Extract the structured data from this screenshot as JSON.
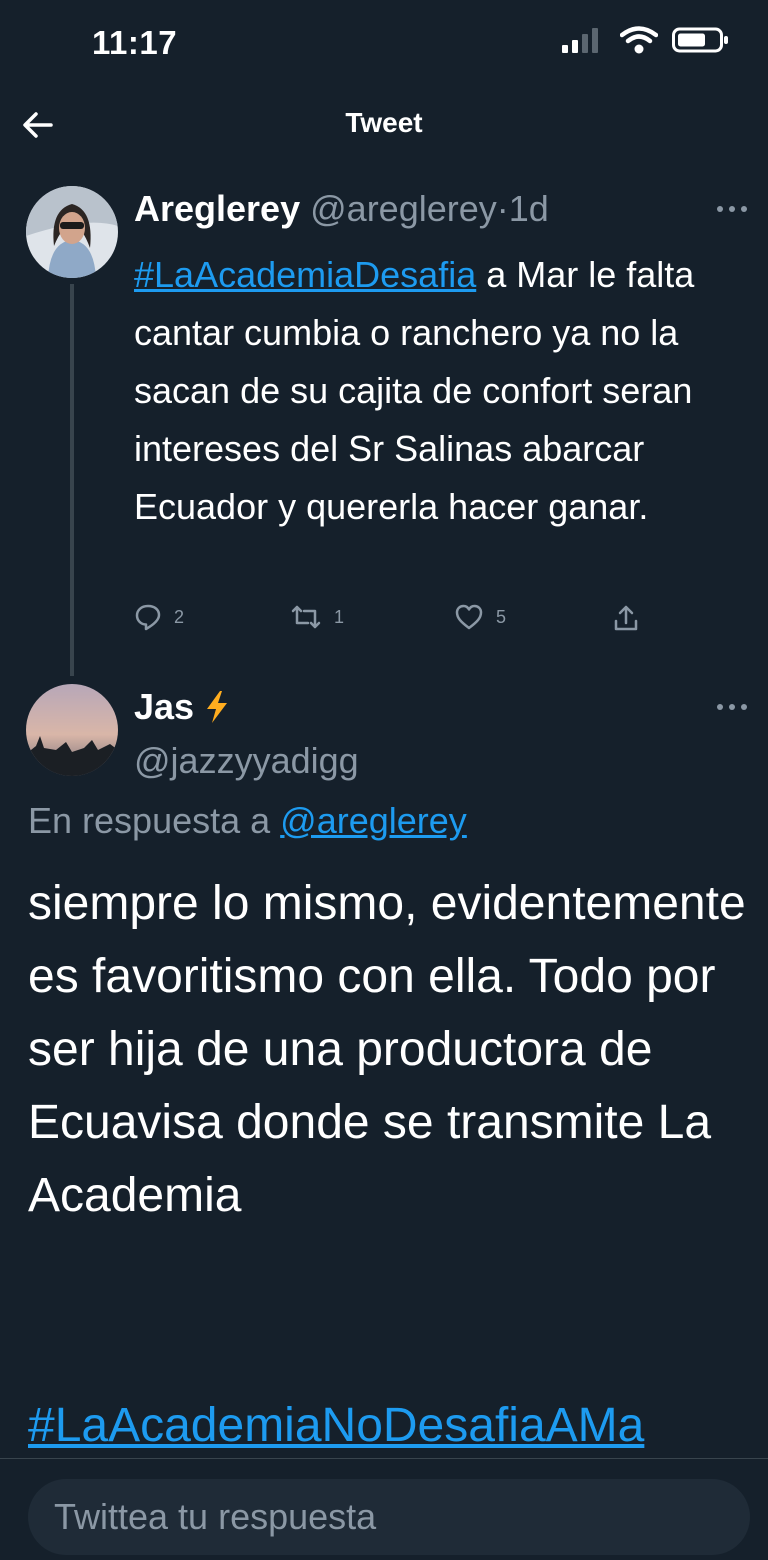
{
  "status_bar": {
    "time": "11:17"
  },
  "nav": {
    "title": "Tweet"
  },
  "tweet1": {
    "name": "Areglerey",
    "handle": "@areglerey",
    "separator": "·",
    "age": "1d",
    "hashtag": "#LaAcademiaDesafia",
    "text": " a Mar le falta cantar cumbia o ranchero ya no la sacan de su cajita de confort seran intereses del Sr Salinas abarcar Ecuador y quererla hacer ganar.",
    "replies": "2",
    "retweets": "1",
    "likes": "5"
  },
  "tweet2": {
    "name": "Jas",
    "handle": "@jazzyyadigg",
    "reply_prefix": "En respuesta a",
    "reply_to": "@areglerey",
    "text": "siempre lo mismo, evidentemente es favoritismo con ella. Todo por ser hija de una productora de Ecuavisa donde se transmite La Academia",
    "hashtag": "#LaAcademiaNoDesafiaAMa"
  },
  "reply": {
    "placeholder": "Twittea tu respuesta"
  },
  "colors": {
    "background": "#15202b",
    "link": "#1d9bf0",
    "muted": "#8b98a5",
    "lightning": "#ffad1f"
  }
}
